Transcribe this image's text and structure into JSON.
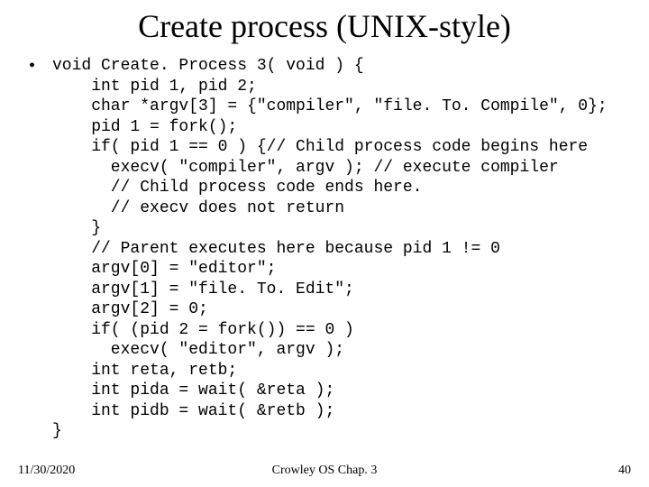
{
  "title": "Create process (UNIX-style)",
  "bullet": "•",
  "code_lines": [
    "void Create. Process 3( void ) {",
    "    int pid 1, pid 2;",
    "    char *argv[3] = {\"compiler\", \"file. To. Compile\", 0};",
    "    pid 1 = fork();",
    "    if( pid 1 == 0 ) {// Child process code begins here",
    "      execv( \"compiler\", argv ); // execute compiler",
    "      // Child process code ends here.",
    "      // execv does not return",
    "    }",
    "    // Parent executes here because pid 1 != 0",
    "    argv[0] = \"editor\";",
    "    argv[1] = \"file. To. Edit\";",
    "    argv[2] = 0;",
    "    if( (pid 2 = fork()) == 0 )",
    "      execv( \"editor\", argv );",
    "    int reta, retb;",
    "    int pida = wait( &reta );",
    "    int pidb = wait( &retb );",
    "}"
  ],
  "footer": {
    "date": "11/30/2020",
    "center": "Crowley    OS     Chap. 3",
    "page": "40"
  }
}
